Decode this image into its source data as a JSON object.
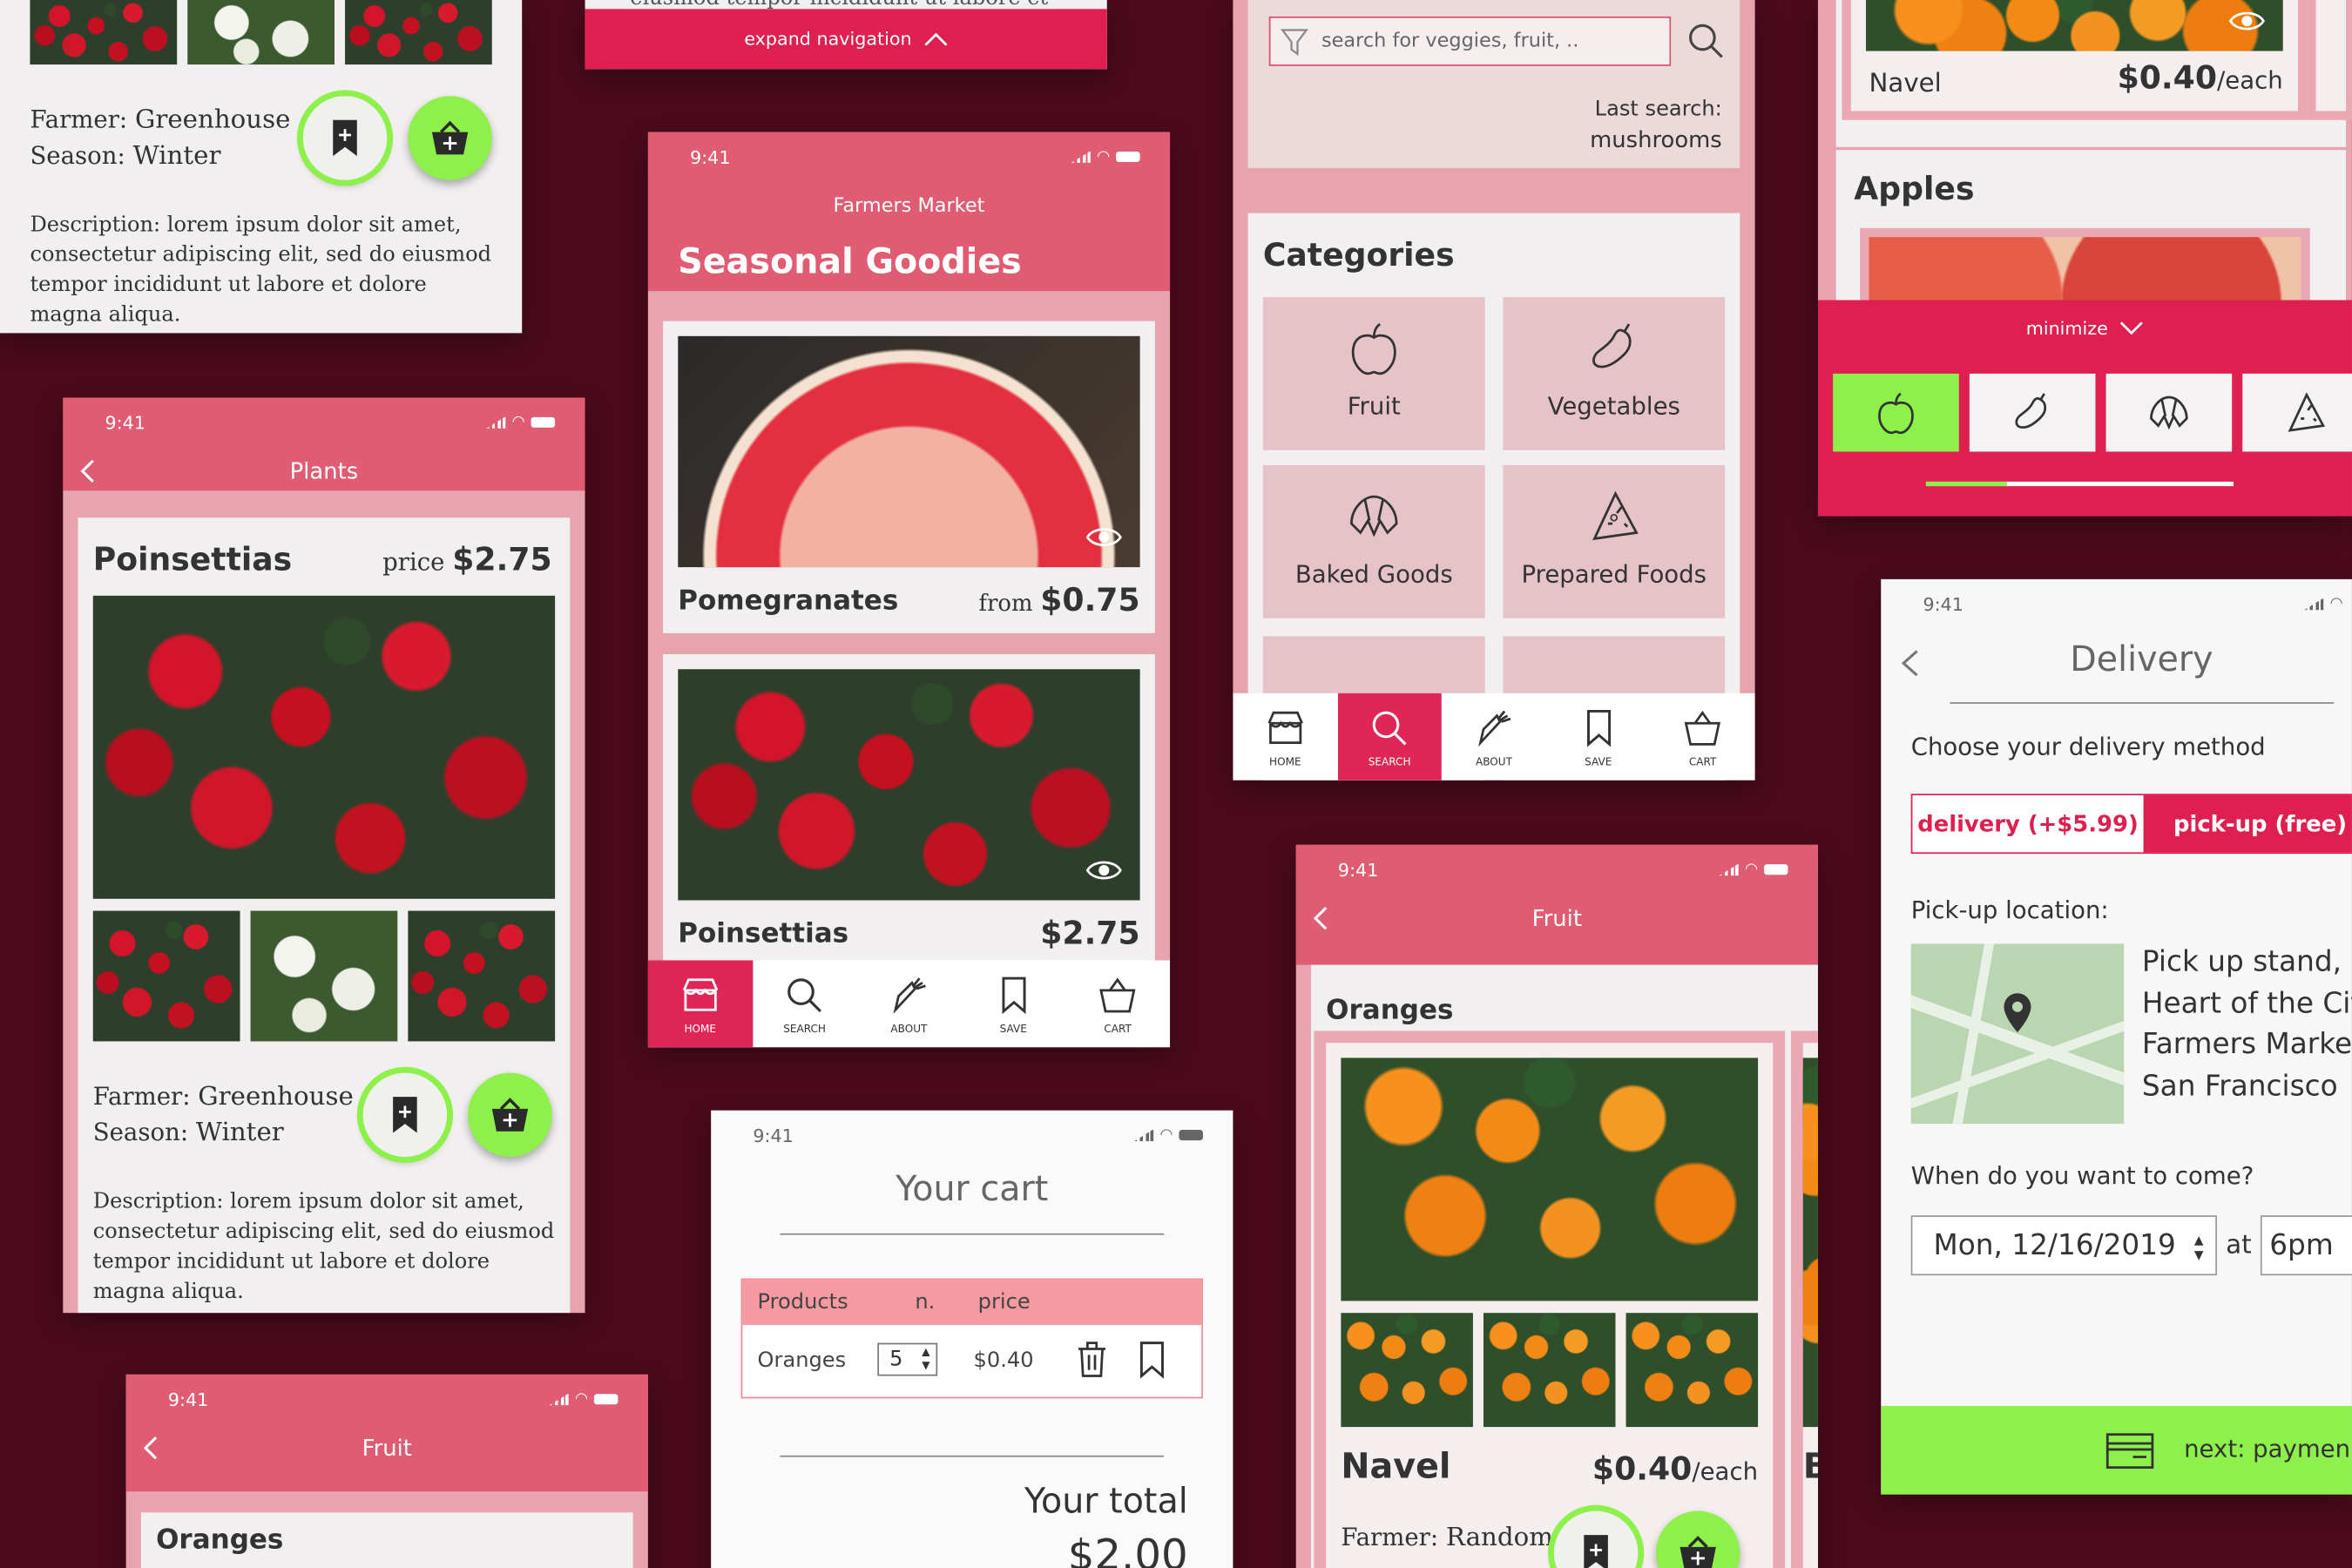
{
  "status_time": "9:41",
  "plants_top": {
    "farmer_label": "Farmer:",
    "farmer": "Greenhouse",
    "season_label": "Season:",
    "season": "Winter",
    "description": "Description: lorem ipsum dolor sit amet, consectetur adipiscing elit, sed do eiusmod tempor incididunt ut labore et dolore magna aliqua."
  },
  "expand_bar": {
    "cut_text": "eiusmod tempor incididunt ut labore et",
    "label": "expand navigation"
  },
  "plants": {
    "header_title": "Plants",
    "product": "Poinsettias",
    "price_label": "price",
    "price": "$2.75",
    "farmer_label": "Farmer:",
    "farmer": "Greenhouse",
    "season_label": "Season:",
    "season": "Winter",
    "description": "Description: lorem ipsum dolor sit amet, consectetur adipiscing elit, sed do eiusmod tempor incididunt ut labore et dolore magna aliqua."
  },
  "fruit_small": {
    "header_title": "Fruit",
    "section": "Oranges"
  },
  "home": {
    "app_title": "Farmers Market",
    "heading": "Seasonal Goodies",
    "cards": [
      {
        "name": "Pomegranates",
        "from_label": "from",
        "price": "$0.75"
      },
      {
        "name": "Poinsettias",
        "price": "$2.75"
      }
    ]
  },
  "nav": {
    "home": "HOME",
    "search": "SEARCH",
    "about": "ABOUT",
    "save": "SAVE",
    "cart": "CART"
  },
  "cart": {
    "title": "Your cart",
    "col_products": "Products",
    "col_n": "n.",
    "col_price": "price",
    "row_product": "Oranges",
    "row_qty": "5",
    "row_price": "$0.40",
    "total_label": "Your total",
    "total_value": "$2.00"
  },
  "search": {
    "placeholder": "search for veggies, fruit, ..",
    "last_search_label": "Last search:",
    "last_search": "mushrooms",
    "categories_title": "Categories",
    "categories": [
      "Fruit",
      "Vegetables",
      "Baked Goods",
      "Prepared Foods"
    ]
  },
  "fruit_detail": {
    "header_title": "Fruit",
    "section": "Oranges",
    "product": "Navel",
    "price": "$0.40",
    "unit": "/each",
    "farmer_label": "Farmer:",
    "farmer": "Random",
    "side_letter": "B"
  },
  "apples_panel": {
    "navel": "Navel",
    "navel_price": "$0.40",
    "navel_unit": "/each",
    "section": "Apples",
    "minimize": "minimize"
  },
  "delivery": {
    "title": "Delivery",
    "subtitle": "Choose your delivery method",
    "opt_delivery": "delivery (+$5.99)",
    "opt_pickup": "pick-up (free)",
    "location_label": "Pick-up location:",
    "location": [
      "Pick up stand,",
      "Heart of the Cit",
      "Farmers Marke",
      "San Francisco"
    ],
    "when_label": "When do you want to come?",
    "date": "Mon, 12/16/2019",
    "at": "at",
    "time": "6pm",
    "next": "next: paymen"
  },
  "colors": {
    "background": "#4c0a1d",
    "header_pink": "#df5c73",
    "accent_red": "#df2656",
    "green": "#8ef04a"
  }
}
